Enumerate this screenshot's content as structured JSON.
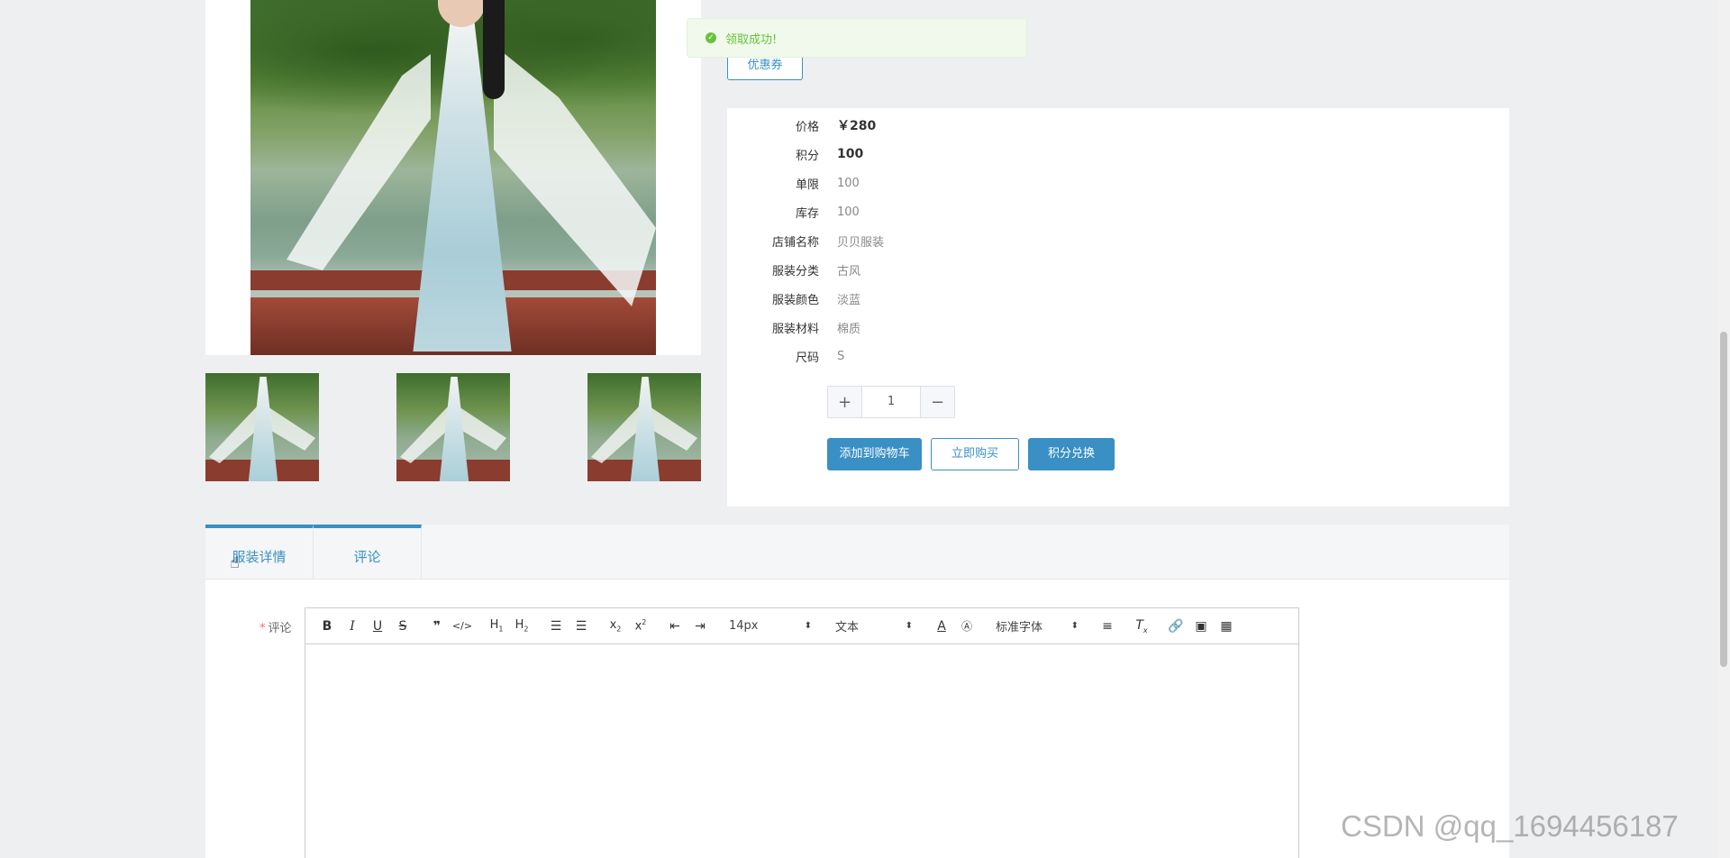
{
  "toast": {
    "message": "领取成功!",
    "icon": "success-check-icon"
  },
  "coupon": {
    "label": "优惠券"
  },
  "product": {
    "fields": [
      {
        "label": "价格",
        "value": "￥280",
        "bold": true
      },
      {
        "label": "积分",
        "value": "100",
        "bold": true
      },
      {
        "label": "单限",
        "value": "100",
        "bold": false
      },
      {
        "label": "库存",
        "value": "100",
        "bold": false
      },
      {
        "label": "店铺名称",
        "value": "贝贝服装",
        "bold": false
      },
      {
        "label": "服装分类",
        "value": "古风",
        "bold": false
      },
      {
        "label": "服装颜色",
        "value": "淡蓝",
        "bold": false
      },
      {
        "label": "服装材料",
        "value": "棉质",
        "bold": false
      },
      {
        "label": "尺码",
        "value": "S",
        "bold": false
      }
    ],
    "quantity": "1"
  },
  "actions": {
    "add_to_cart": "添加到购物车",
    "buy_now": "立即购买",
    "redeem_points": "积分兑换"
  },
  "tabs": [
    {
      "label": "服装详情"
    },
    {
      "label": "评论"
    }
  ],
  "comment_form": {
    "label": "评论",
    "required_mark": "*",
    "font_size": "14px",
    "header_select": "文本",
    "font_family_select": "标准字体"
  },
  "watermark": "CSDN @qq_1694456187",
  "colors": {
    "accent": "#3a8fc4",
    "success": "#67c23a",
    "required": "#f56c6c"
  }
}
